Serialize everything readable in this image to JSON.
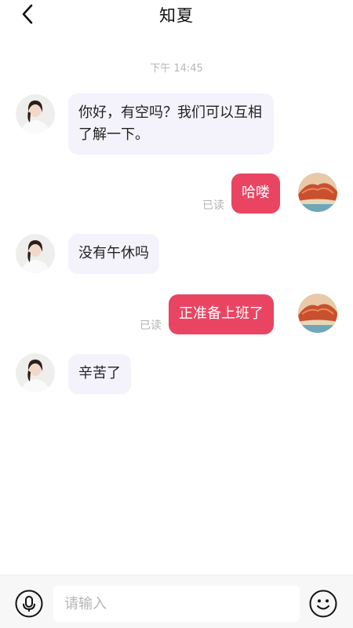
{
  "header": {
    "title": "知夏",
    "back_icon": "chevron-left-icon"
  },
  "chat": {
    "timestamp": "下午 14:45",
    "messages": [
      {
        "side": "in",
        "text": "你好，有空吗？我们可以互相了解一下。"
      },
      {
        "side": "out",
        "text": "哈喽",
        "read": "已读"
      },
      {
        "side": "in",
        "text": "没有午休吗"
      },
      {
        "side": "out",
        "text": "正准备上班了",
        "read": "已读"
      },
      {
        "side": "in",
        "text": "辛苦了"
      }
    ]
  },
  "input_bar": {
    "placeholder": "请输入",
    "mic_icon": "microphone-icon",
    "emoji_icon": "emoji-icon"
  },
  "colors": {
    "outgoing_bubble": "#e94563",
    "incoming_bubble": "#f4f3fb",
    "timestamp_text": "#b7b7b7"
  }
}
